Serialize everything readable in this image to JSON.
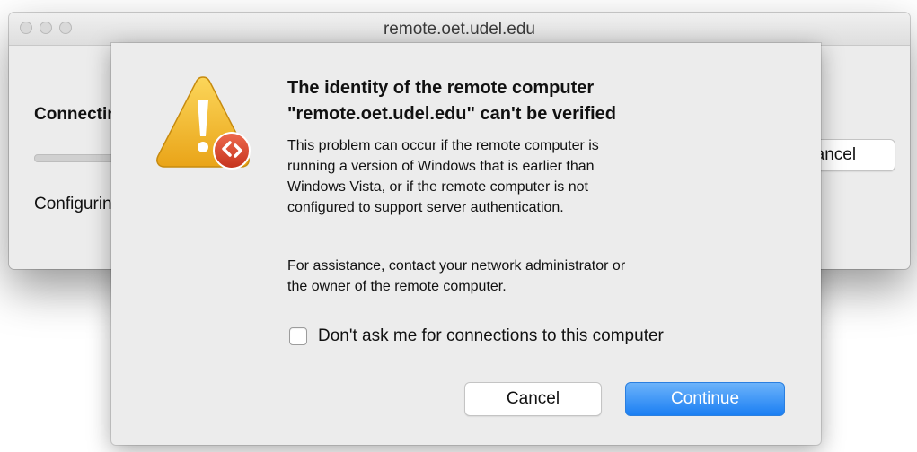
{
  "window": {
    "title": "remote.oet.udel.edu",
    "heading": "Connecting",
    "status": "Configuring",
    "cancel_label": "Cancel"
  },
  "icons": {
    "warning": "warning-triangle-icon",
    "badge": "remote-desktop-icon"
  },
  "dialog": {
    "heading_lines": [
      "The identity of the remote computer",
      "\"remote.oet.udel.edu\" can't be verified"
    ],
    "body_paragraph_1": [
      "This problem can occur if the remote computer is",
      "running a version of Windows that is earlier than",
      "Windows Vista, or if the remote computer is not",
      "configured to support server authentication."
    ],
    "body_paragraph_2": [
      "For assistance, contact your network administrator or",
      "the owner of the remote computer."
    ],
    "checkbox_label": "Don't ask me for connections to this computer",
    "checkbox_checked": false,
    "cancel_label": "Cancel",
    "continue_label": "Continue"
  },
  "colors": {
    "accent": "#1b7ff3",
    "warning": "#f3b72a",
    "badge": "#d8432b"
  }
}
